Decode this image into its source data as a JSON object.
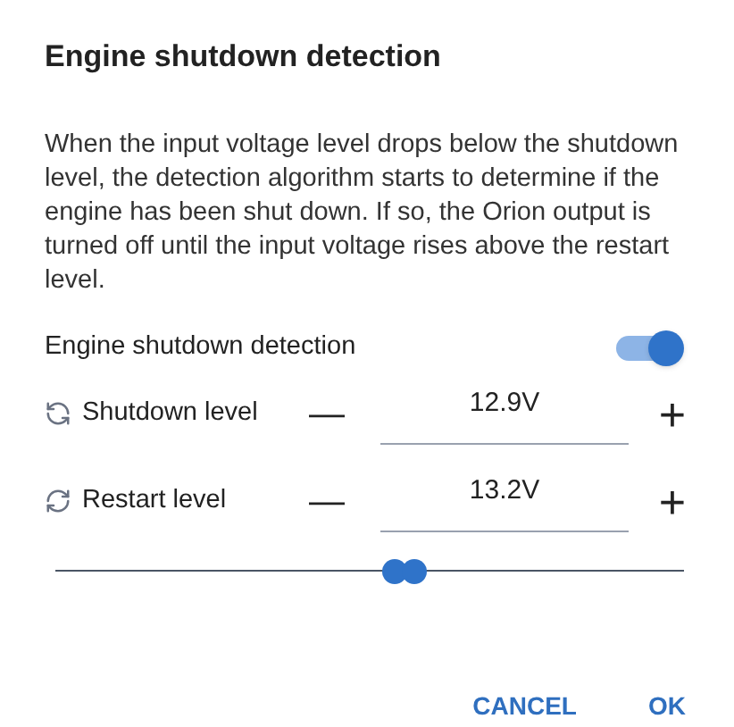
{
  "dialog": {
    "title": "Engine shutdown detection",
    "description": "When the input voltage level drops below the shutdown level, the detection algorithm starts to determine if the engine has been shut down. If so, the Orion output is turned off until the input voltage rises above the restart level.",
    "toggle": {
      "label": "Engine shutdown detection",
      "on": true
    },
    "levels": [
      {
        "kind": "shutdown",
        "label": "Shutdown level",
        "minus": "—",
        "value": "12.9V",
        "plus": "+"
      },
      {
        "kind": "restart",
        "label": "Restart level",
        "minus": "—",
        "value": "13.2V",
        "plus": "+"
      }
    ],
    "range": {
      "thumbs": [
        {
          "level": 0.54
        },
        {
          "level": 0.571
        }
      ]
    },
    "buttons": [
      "CANCEL",
      "OK"
    ]
  }
}
